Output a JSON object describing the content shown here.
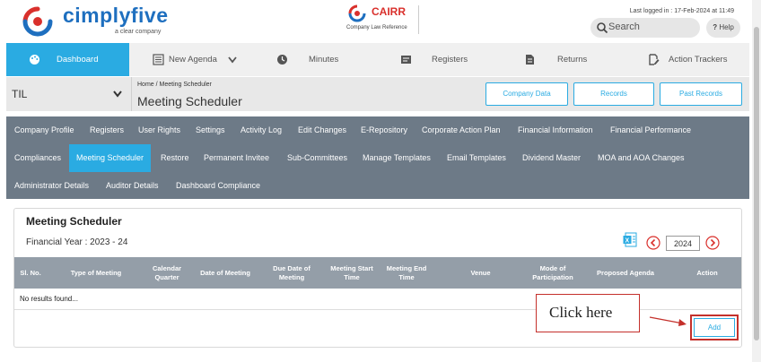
{
  "header": {
    "logo_text": "cimplyfive",
    "logo_sub": "a clear company",
    "cairr_text": "CAIRR",
    "cairr_sub": "Company Law Reference",
    "last_login": "Last logged in : 17-Feb-2024 at 11:49",
    "search_label": "Search",
    "help_label": "Help",
    "help_icon": "?"
  },
  "mainnav": {
    "items": [
      {
        "label": "Dashboard",
        "icon": "palette-icon"
      },
      {
        "label": "New Agenda",
        "icon": "list-icon"
      },
      {
        "label": "Minutes",
        "icon": "clock-icon"
      },
      {
        "label": "Registers",
        "icon": "register-icon"
      },
      {
        "label": "Returns",
        "icon": "document-icon"
      },
      {
        "label": "Action Trackers",
        "icon": "edit-icon"
      }
    ]
  },
  "company": {
    "name": "TIL",
    "breadcrumb": "Home  /  Meeting Scheduler",
    "page_title": "Meeting Scheduler",
    "buttons": [
      "Company Data",
      "Records",
      "Past Records"
    ]
  },
  "subnav": {
    "row1": [
      "Company Profile",
      "Registers",
      "User Rights",
      "Settings",
      "Activity Log",
      "Edit Changes",
      "E-Repository",
      "Corporate Action Plan",
      "Financial Information",
      "Financial Performance"
    ],
    "row2": [
      "Compliances",
      "Meeting Scheduler",
      "Restore",
      "Permanent Invitee",
      "Sub-Committees",
      "Manage Templates",
      "Email Templates",
      "Dividend Master",
      "MOA and AOA Changes"
    ],
    "row3": [
      "Administrator Details",
      "Auditor Details",
      "Dashboard Compliance"
    ],
    "active": "Meeting Scheduler"
  },
  "panel": {
    "title": "Meeting Scheduler",
    "financial_year": "Financial Year : 2023 - 24",
    "year_value": "2024",
    "columns": [
      "Sl. No.",
      "Type of Meeting",
      "Calendar\nQuarter",
      "Date of Meeting",
      "Due Date of\nMeeting",
      "Meeting Start\nTime",
      "Meeting End\nTime",
      "Venue",
      "Mode of\nParticipation",
      "Proposed Agenda",
      "Action"
    ],
    "no_results": "No results found...",
    "add_label": "Add"
  },
  "annotation": {
    "text": "Click here"
  },
  "colors": {
    "accent": "#2aabe2",
    "subnav_bg": "#6d7a87",
    "table_header_bg": "#949ea8",
    "annotation_red": "#c4302b",
    "logo_blue": "#1e6fbf",
    "logo_red": "#d9302c"
  }
}
